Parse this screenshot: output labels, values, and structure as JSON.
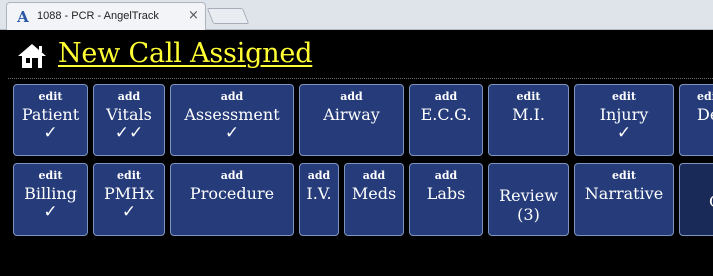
{
  "browser": {
    "tab_title": "1088 - PCR - AngelTrack",
    "tab_icon": "A",
    "close_glyph": "×"
  },
  "header": {
    "title": "New Call Assigned"
  },
  "buttons": [
    {
      "action": "edit",
      "label": "Patient",
      "mark": "✓"
    },
    {
      "action": "add",
      "label": "Vitals",
      "mark": "✓✓"
    },
    {
      "action": "add",
      "label": "Assessment",
      "mark": "✓"
    },
    {
      "action": "add",
      "label": "Airway",
      "mark": ""
    },
    {
      "action": "add",
      "label": "E.C.G.",
      "mark": ""
    },
    {
      "action": "edit",
      "label": "M.I.",
      "mark": ""
    },
    {
      "action": "edit",
      "label": "Injury",
      "mark": "✓"
    },
    {
      "action": "edit",
      "label": "De",
      "mark": ""
    },
    {
      "action": "edit",
      "label": "Billing",
      "mark": "✓"
    },
    {
      "action": "edit",
      "label": "PMHx",
      "mark": "✓"
    },
    {
      "action": "add",
      "label": "Procedure",
      "mark": ""
    },
    {
      "action": "add",
      "label": "I.V.",
      "mark": ""
    },
    {
      "action": "add",
      "label": "Meds",
      "mark": ""
    },
    {
      "action": "add",
      "label": "Labs",
      "mark": ""
    },
    {
      "action": "",
      "label": "Review",
      "sub": "(3)"
    },
    {
      "action": "edit",
      "label": "Narrative",
      "mark": ""
    },
    {
      "action": "",
      "label": "C",
      "mark": ""
    }
  ]
}
